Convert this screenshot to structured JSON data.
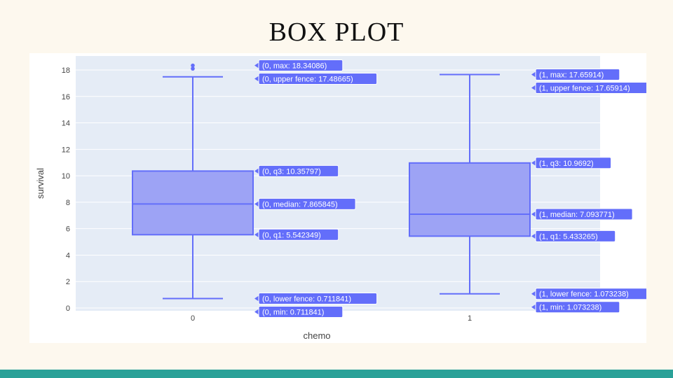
{
  "slide": {
    "title": "BOX PLOT"
  },
  "colors": {
    "box_fill": "#9da3f5",
    "box_line": "#636efa",
    "plot_bg": "#e5ecf6",
    "footer": "#2aa198",
    "hover_bg": "#636efa"
  },
  "chart_data": {
    "type": "box",
    "xlabel": "chemo",
    "ylabel": "survival",
    "ylim": [
      0,
      19
    ],
    "yticks": [
      "0",
      "2",
      "4",
      "6",
      "8",
      "10",
      "12",
      "14",
      "16",
      "18"
    ],
    "grid": true,
    "groups": [
      {
        "category": "0",
        "min": 0.711841,
        "lower_fence": 0.711841,
        "q1": 5.542349,
        "median": 7.865845,
        "q3": 10.35797,
        "upper_fence": 17.48665,
        "max": 18.34086,
        "outliers": [
          18.1,
          18.34086
        ],
        "labels": {
          "max": "(0, max: 18.34086)",
          "upper_fence": "(0, upper fence: 17.48665)",
          "q3": "(0, q3: 10.35797)",
          "median": "(0, median: 7.865845)",
          "q1": "(0, q1: 5.542349)",
          "lower_fence": "(0, lower fence: 0.711841)",
          "min": "(0, min: 0.711841)"
        }
      },
      {
        "category": "1",
        "min": 1.073238,
        "lower_fence": 1.073238,
        "q1": 5.433265,
        "median": 7.093771,
        "q3": 10.9692,
        "upper_fence": 17.65914,
        "max": 17.65914,
        "outliers": [],
        "labels": {
          "max": "(1, max: 17.65914)",
          "upper_fence": "(1, upper fence: 17.65914)",
          "q3": "(1, q3: 10.9692)",
          "median": "(1, median: 7.093771)",
          "q1": "(1, q1: 5.433265)",
          "lower_fence": "(1, lower fence: 1.073238)",
          "min": "(1, min: 1.073238)"
        }
      }
    ]
  }
}
